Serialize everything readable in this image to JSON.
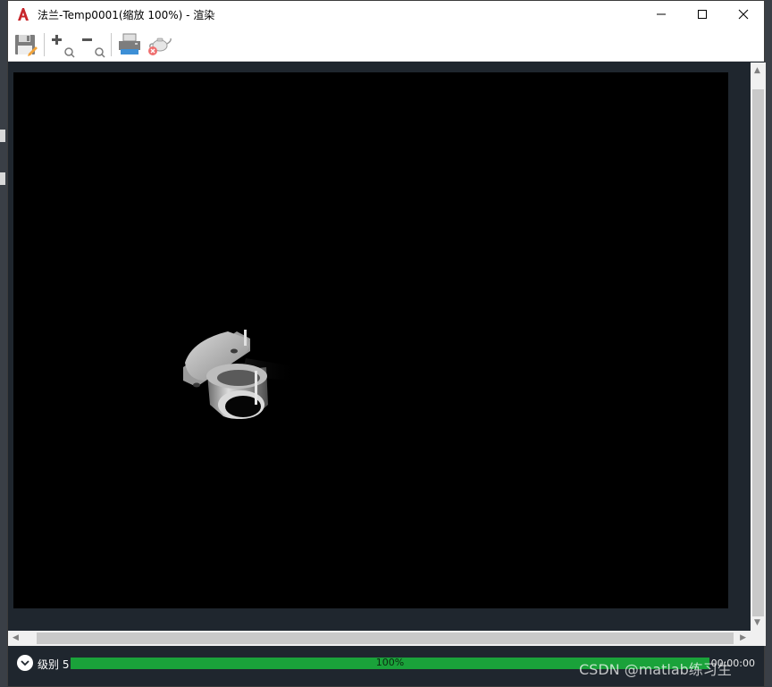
{
  "window": {
    "title": "法兰-Temp0001(缩放 100%) - 渲染",
    "app_icon": "autocad-icon",
    "controls": [
      "minimize-icon",
      "maximize-icon",
      "close-icon"
    ]
  },
  "toolbar": {
    "buttons": [
      {
        "name": "save-button",
        "icon": "save-icon"
      },
      {
        "name": "zoom-in-button",
        "icon": "zoom-in-icon"
      },
      {
        "name": "zoom-out-button",
        "icon": "zoom-out-icon"
      },
      {
        "name": "print-button",
        "icon": "print-icon"
      },
      {
        "name": "cancel-render-button",
        "icon": "teapot-cancel-icon"
      }
    ]
  },
  "viewport": {
    "background": "#000000",
    "object": "flange-render"
  },
  "status": {
    "level_label": "级别 5",
    "progress_percent": 100,
    "progress_text": "100%",
    "elapsed_time": "00:00:00"
  },
  "colors": {
    "progress": "#1aa23a",
    "frame": "#1f262e",
    "app_icon": "#c8262b"
  },
  "watermark": "CSDN @matlab练习生"
}
